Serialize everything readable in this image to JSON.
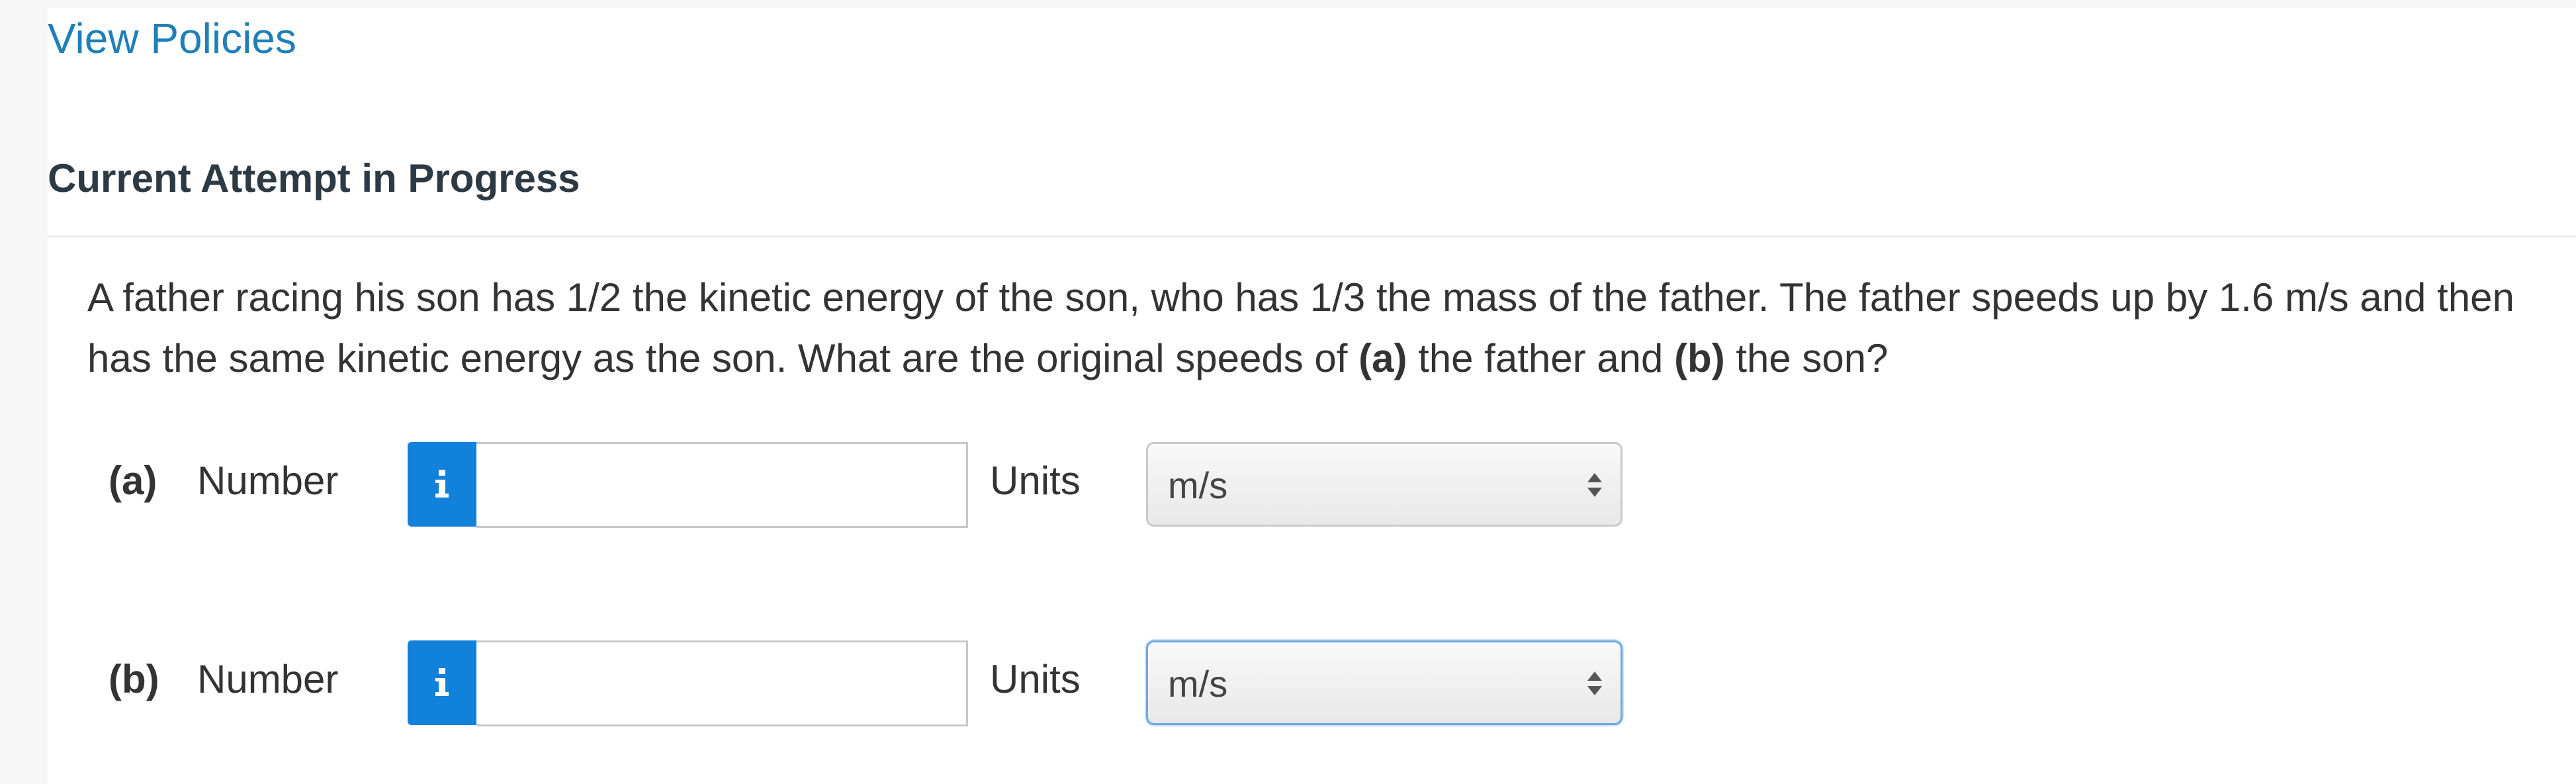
{
  "header": {
    "policies_link": "View Policies",
    "section_title": "Current Attempt in Progress"
  },
  "question": {
    "text_part1": "A father racing his son has 1/2 the kinetic energy of the son, who has 1/3 the mass of the father. The father speeds up by 1.6 m/s and then has the same kinetic energy as the son. What are the original speeds of ",
    "part_a_marker": "(a)",
    "text_part2": " the father and ",
    "part_b_marker": "(b)",
    "text_part3": " the son?"
  },
  "answers": [
    {
      "part_label": "(a)",
      "number_label": "Number",
      "number_value": "",
      "info_icon": "info-icon",
      "units_label": "Units",
      "units_selected": "m/s"
    },
    {
      "part_label": "(b)",
      "number_label": "Number",
      "number_value": "",
      "info_icon": "info-icon",
      "units_label": "Units",
      "units_selected": "m/s"
    }
  ],
  "colors": {
    "link": "#1f7fb8",
    "info_button": "#1181d9",
    "focus_border": "#6aa9e4"
  }
}
